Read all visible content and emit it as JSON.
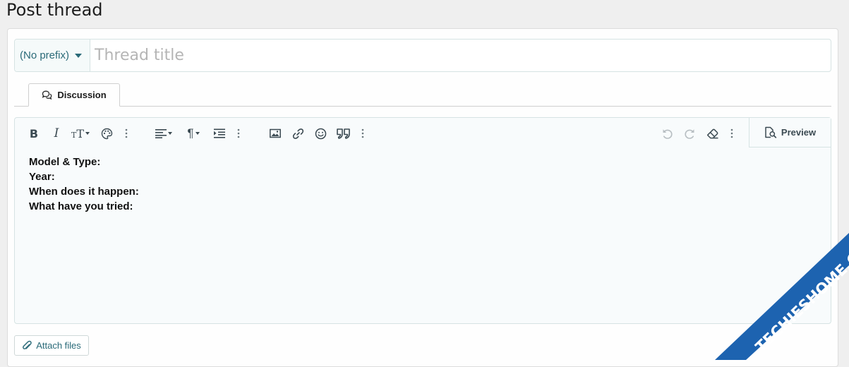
{
  "page": {
    "title": "Post thread"
  },
  "thread": {
    "prefix_label": "(No prefix)",
    "title_placeholder": "Thread title",
    "title_value": ""
  },
  "tabs": [
    {
      "label": "Discussion",
      "icon": "comments-icon",
      "active": true
    }
  ],
  "toolbar": {
    "left_groups": [
      [
        "bold-icon",
        "italic-icon",
        "font-size-icon",
        "color-palette-icon",
        "more-vertical-icon"
      ],
      [
        "align-left-icon",
        "paragraph-icon",
        "indent-icon",
        "more-vertical-icon"
      ],
      [
        "image-icon",
        "link-icon",
        "smiley-icon",
        "quote-icon",
        "more-vertical-icon"
      ]
    ],
    "right_group": [
      "undo-icon",
      "redo-icon",
      "eraser-icon",
      "more-vertical-icon"
    ],
    "preview_label": "Preview"
  },
  "editor": {
    "lines": [
      "Model & Type:",
      "Year:",
      "When does it happen:",
      "What have you tried:"
    ]
  },
  "attach": {
    "label": "Attach files"
  },
  "watermark": {
    "text": "TECHIESHOME.COM"
  },
  "colors": {
    "accent": "#2a6a78",
    "background": "#efefef",
    "editor_bg": "#f8fbfc",
    "watermark_blue": "#1d63b0"
  }
}
